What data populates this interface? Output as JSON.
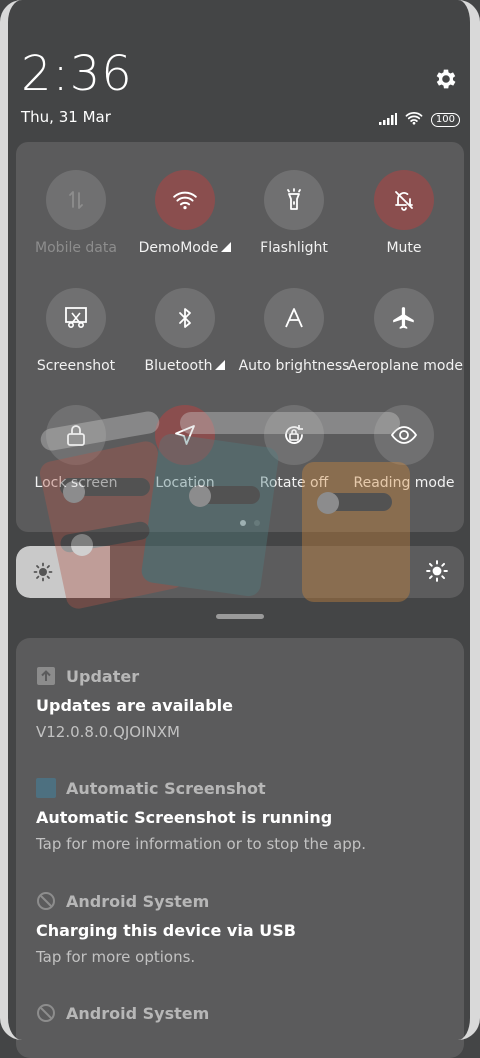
{
  "status": {
    "time": "2:36",
    "date": "Thu, 31 Mar",
    "battery": "100",
    "icons": [
      "signal-icon",
      "wifi-icon",
      "battery-icon"
    ]
  },
  "quick_settings": {
    "tiles": [
      {
        "label": "Mobile data",
        "icon": "mobile-data-icon",
        "active": false,
        "disabled": true
      },
      {
        "label": "DemoMode",
        "icon": "wifi-icon",
        "active": true,
        "expandable": true
      },
      {
        "label": "Flashlight",
        "icon": "flashlight-icon",
        "active": false
      },
      {
        "label": "Mute",
        "icon": "bell-off-icon",
        "active": true
      },
      {
        "label": "Screenshot",
        "icon": "screenshot-icon",
        "active": false
      },
      {
        "label": "Bluetooth",
        "icon": "bluetooth-icon",
        "active": false,
        "expandable": true
      },
      {
        "label": "Auto brightness",
        "icon": "auto-brightness-icon",
        "active": false
      },
      {
        "label": "Aeroplane mode",
        "icon": "airplane-icon",
        "active": false
      },
      {
        "label": "Lock screen",
        "icon": "lock-icon",
        "active": false
      },
      {
        "label": "Location",
        "icon": "location-icon",
        "active": true
      },
      {
        "label": "Rotate off",
        "icon": "rotate-lock-icon",
        "active": false
      },
      {
        "label": "Reading mode",
        "icon": "eye-icon",
        "active": false
      }
    ],
    "page_count": 2,
    "current_page": 1
  },
  "brightness": {
    "level": 0.21
  },
  "notifications": [
    {
      "app": "Updater",
      "icon": "updater-icon",
      "title": "Updates are available",
      "text": "V12.0.8.0.QJOINXM"
    },
    {
      "app": "Automatic Screenshot",
      "icon": "app-square-icon",
      "title": "Automatic Screenshot is running",
      "text": "Tap for more information or to stop the app."
    },
    {
      "app": "Android System",
      "icon": "android-system-icon",
      "title": "Charging this device via USB",
      "text": "Tap for more options."
    },
    {
      "app": "Android System",
      "icon": "android-system-icon",
      "title": "",
      "text": ""
    }
  ],
  "colors": {
    "background": "#444546",
    "panel": "#5b5b5c",
    "active_tile": "#8a4e4e",
    "inactive_tile": "#707071"
  }
}
